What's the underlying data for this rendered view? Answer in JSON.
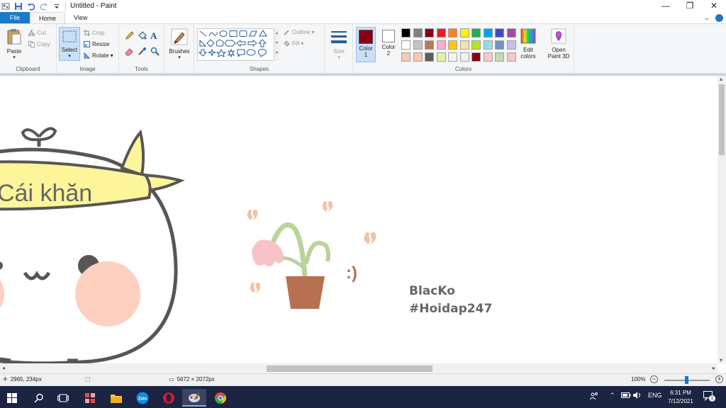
{
  "window": {
    "title": "Untitled - Paint",
    "controls": {
      "minimize": "—",
      "restore": "❐",
      "close": "✕"
    }
  },
  "tabs": {
    "file": "File",
    "home": "Home",
    "view": "View"
  },
  "ribbon": {
    "clipboard": {
      "paste": "Paste",
      "cut": "Cut",
      "copy": "Copy",
      "label": "Clipboard"
    },
    "image": {
      "select": "Select",
      "crop": "Crop",
      "resize": "Resize",
      "rotate": "Rotate",
      "label": "Image"
    },
    "tools": {
      "label": "Tools"
    },
    "brushes": {
      "label": "Brushes"
    },
    "shapes": {
      "outline": "Outline",
      "fill": "Fill",
      "label": "Shapes"
    },
    "size": {
      "label": "Size"
    },
    "colors": {
      "color1_label": "Color",
      "color1_num": "1",
      "color2_label": "Color",
      "color2_num": "2",
      "edit_label": "Edit",
      "edit_label2": "colors",
      "label": "Colors",
      "color1_value": "#880015",
      "color2_value": "#ffffff",
      "palette_row1": [
        "#000000",
        "#7f7f7f",
        "#880015",
        "#ed1c24",
        "#ff7f27",
        "#fff200",
        "#22b14c",
        "#00a2e8",
        "#3f48cc",
        "#a349a4"
      ],
      "palette_row2": [
        "#ffffff",
        "#c3c3c3",
        "#b97a57",
        "#ffaec9",
        "#ffc90e",
        "#efe4b0",
        "#b5e61d",
        "#99d9ea",
        "#7092be",
        "#c8bfe7"
      ],
      "palette_row3": [
        "#f6cbb4",
        "#f3c7b3",
        "#5c5c5c",
        "#e3f1a6",
        "#f4f4f4",
        "#f0f0f0",
        "#880015",
        "#f6c9c4",
        "#c6d8b0",
        "#f9c5c5"
      ]
    },
    "paint3d": {
      "line1": "Open",
      "line2": "Paint 3D"
    }
  },
  "canvas": {
    "banner_text": "Cái khăn",
    "signature": "BlacKo",
    "hashtag": "#Hoidap247",
    "smiley": ":)",
    "colors": {
      "banner": "#fdf59a",
      "outline": "#555555",
      "blush": "#fdd0c0",
      "pot": "#b87150",
      "stem": "#b9d39a",
      "flower": "#f6c3c6",
      "heart": "#f3c2a6",
      "text": "#666666"
    }
  },
  "status": {
    "cursor_pos": "2965, 234px",
    "image_size": "5672 × 2072px",
    "zoom": "100%"
  },
  "taskbar": {
    "lang": "ENG",
    "time": "6:31 PM",
    "date": "7/12/2021",
    "notifications": "1"
  }
}
